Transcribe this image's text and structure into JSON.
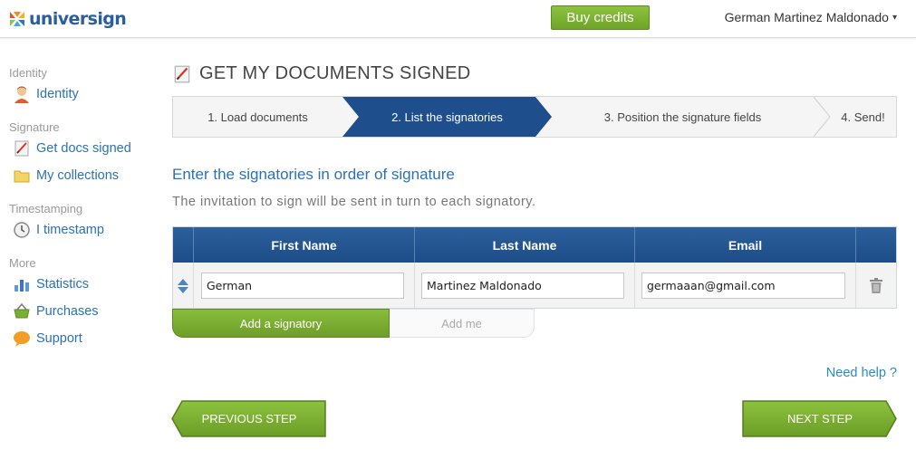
{
  "header": {
    "logo_text": "universign",
    "buy_label": "Buy credits",
    "user_name": "German Martinez Maldonado",
    "caret": "▾"
  },
  "sidebar": {
    "sections": [
      {
        "title": "Identity",
        "items": [
          {
            "label": "Identity",
            "icon": "user-icon"
          }
        ]
      },
      {
        "title": "Signature",
        "items": [
          {
            "label": "Get docs signed",
            "icon": "signed-document-icon"
          },
          {
            "label": "My collections",
            "icon": "folder-icon"
          }
        ]
      },
      {
        "title": "Timestamping",
        "items": [
          {
            "label": "I timestamp",
            "icon": "clock-icon"
          }
        ]
      },
      {
        "title": "More",
        "items": [
          {
            "label": "Statistics",
            "icon": "bar-chart-icon"
          },
          {
            "label": "Purchases",
            "icon": "basket-icon"
          },
          {
            "label": "Support",
            "icon": "speech-bubble-icon"
          }
        ]
      }
    ]
  },
  "main": {
    "title": "GET MY DOCUMENTS SIGNED",
    "steps": [
      {
        "label": "1. Load documents",
        "active": false
      },
      {
        "label": "2. List the signatories",
        "active": true
      },
      {
        "label": "3. Position the signature fields",
        "active": false
      },
      {
        "label": "4. Send!",
        "active": false
      }
    ],
    "heading": "Enter the signatories in order of signature",
    "subtitle": "The invitation to sign will be sent in turn to each signatory.",
    "table": {
      "headers": [
        "First Name",
        "Last Name",
        "Email"
      ],
      "rows": [
        {
          "first_name": "German",
          "last_name": "Martinez Maldonado",
          "email": "germaaan@gmail.com"
        }
      ]
    },
    "add_signatory_label": "Add a signatory",
    "add_me_label": "Add me",
    "help_label": "Need help ?",
    "previous_label": "PREVIOUS STEP",
    "next_label": "NEXT STEP"
  },
  "colors": {
    "accent_blue": "#1d4d87",
    "link_blue": "#2a72b5",
    "green": "#7ab032"
  }
}
